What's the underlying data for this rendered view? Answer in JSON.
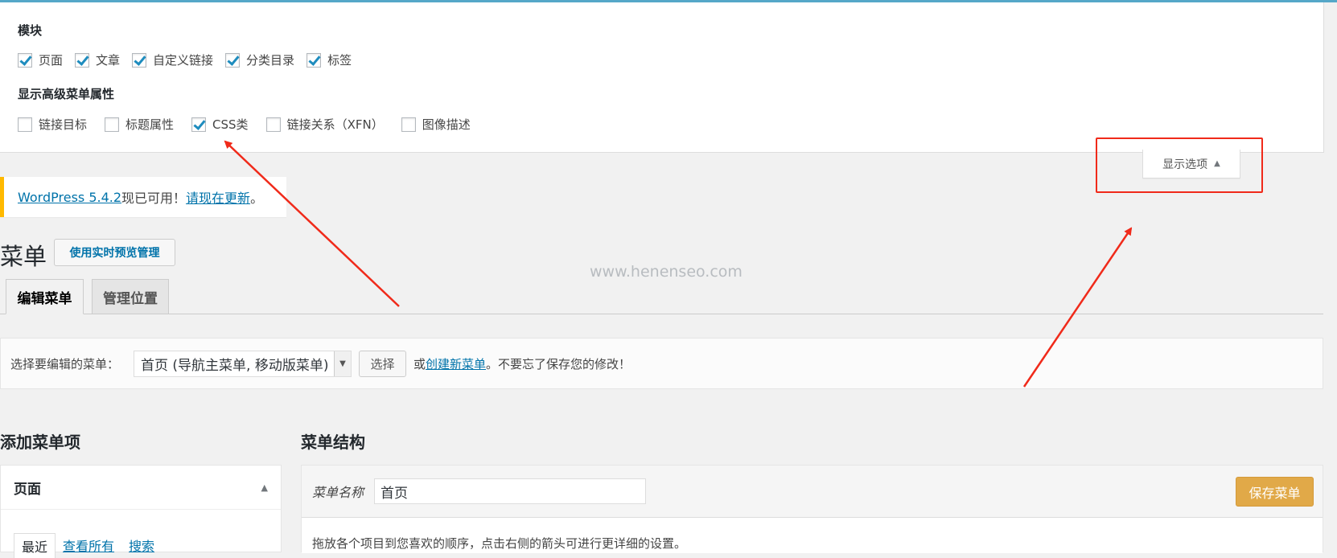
{
  "screen_options": {
    "modules_heading": "模块",
    "modules": [
      {
        "label": "页面",
        "checked": true
      },
      {
        "label": "文章",
        "checked": true
      },
      {
        "label": "自定义链接",
        "checked": true
      },
      {
        "label": "分类目录",
        "checked": true
      },
      {
        "label": "标签",
        "checked": true
      }
    ],
    "advanced_heading": "显示高级菜单属性",
    "advanced": [
      {
        "label": "链接目标",
        "checked": false
      },
      {
        "label": "标题属性",
        "checked": false
      },
      {
        "label": "CSS类",
        "checked": true
      },
      {
        "label": "链接关系（XFN）",
        "checked": false
      },
      {
        "label": "图像描述",
        "checked": false
      }
    ],
    "toggle_label": "显示选项"
  },
  "notice": {
    "link1": "WordPress 5.4.2",
    "middle": "现已可用！",
    "link2": "请现在更新",
    "end": "。"
  },
  "page": {
    "title": "菜单",
    "live_button": "使用实时预览管理",
    "watermark": "www.henenseo.com"
  },
  "tabs": {
    "edit": "编辑菜单",
    "locations": "管理位置"
  },
  "manage": {
    "label": "选择要编辑的菜单：",
    "selected": "首页 (导航主菜单, 移动版菜单)",
    "select_button": "选择",
    "or": "或",
    "create_link": "创建新菜单",
    "reminder": "。不要忘了保存您的修改！"
  },
  "add_items": {
    "title": "添加菜单项",
    "panel_title": "页面",
    "tabs": [
      "最近",
      "查看所有",
      "搜索"
    ]
  },
  "structure": {
    "title": "菜单结构",
    "name_label": "菜单名称",
    "name_value": "首页",
    "save_button": "保存菜单",
    "instructions": "拖放各个项目到您喜欢的顺序，点击右侧的箭头可进行更详细的设置。"
  },
  "colors": {
    "accent": "#0073aa",
    "annotation": "#f02a1a",
    "save": "#e1a948",
    "notice_border": "#ffb900"
  }
}
